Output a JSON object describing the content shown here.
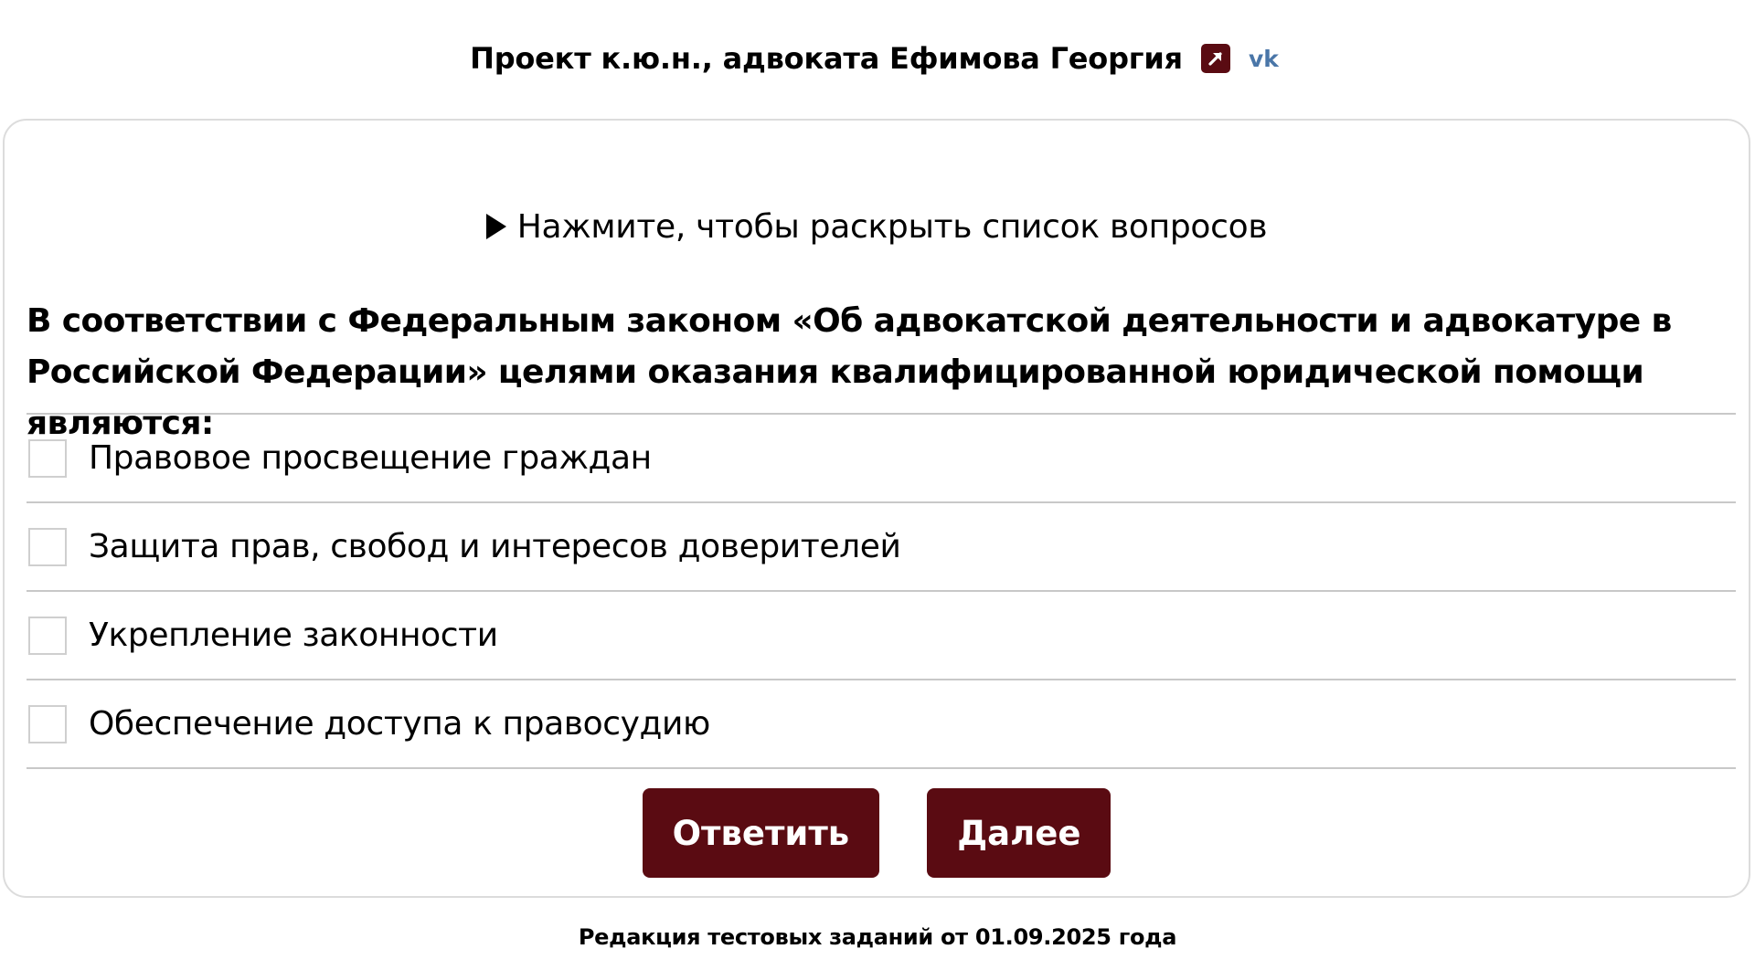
{
  "header": {
    "title": "Проект к.ю.н., адвоката Ефимова Георгия",
    "external_link_icon": "external-link-icon",
    "vk_icon": "vk-icon",
    "vk_label": "vk",
    "accent_color": "#5a0b12",
    "vk_color": "#4a76a8"
  },
  "toggle": {
    "label": "Нажмите, чтобы раскрыть список вопросов",
    "icon": "triangle-right-icon"
  },
  "question": {
    "text": "В соответствии с Федеральным законом «Об адвокатской деятельности и адвокатуре в Российской Федерации» целями оказания квалифицированной юридической помощи являются:"
  },
  "options": [
    {
      "label": "Правовое просвещение граждан",
      "checked": false
    },
    {
      "label": "Защита прав, свобод и интересов доверителей",
      "checked": false
    },
    {
      "label": "Укрепление законности",
      "checked": false
    },
    {
      "label": "Обеспечение доступа к правосудию",
      "checked": false
    }
  ],
  "buttons": {
    "answer_label": "Ответить",
    "next_label": "Далее"
  },
  "footer": {
    "text": "Редакция тестовых заданий от 01.09.2025 года"
  }
}
